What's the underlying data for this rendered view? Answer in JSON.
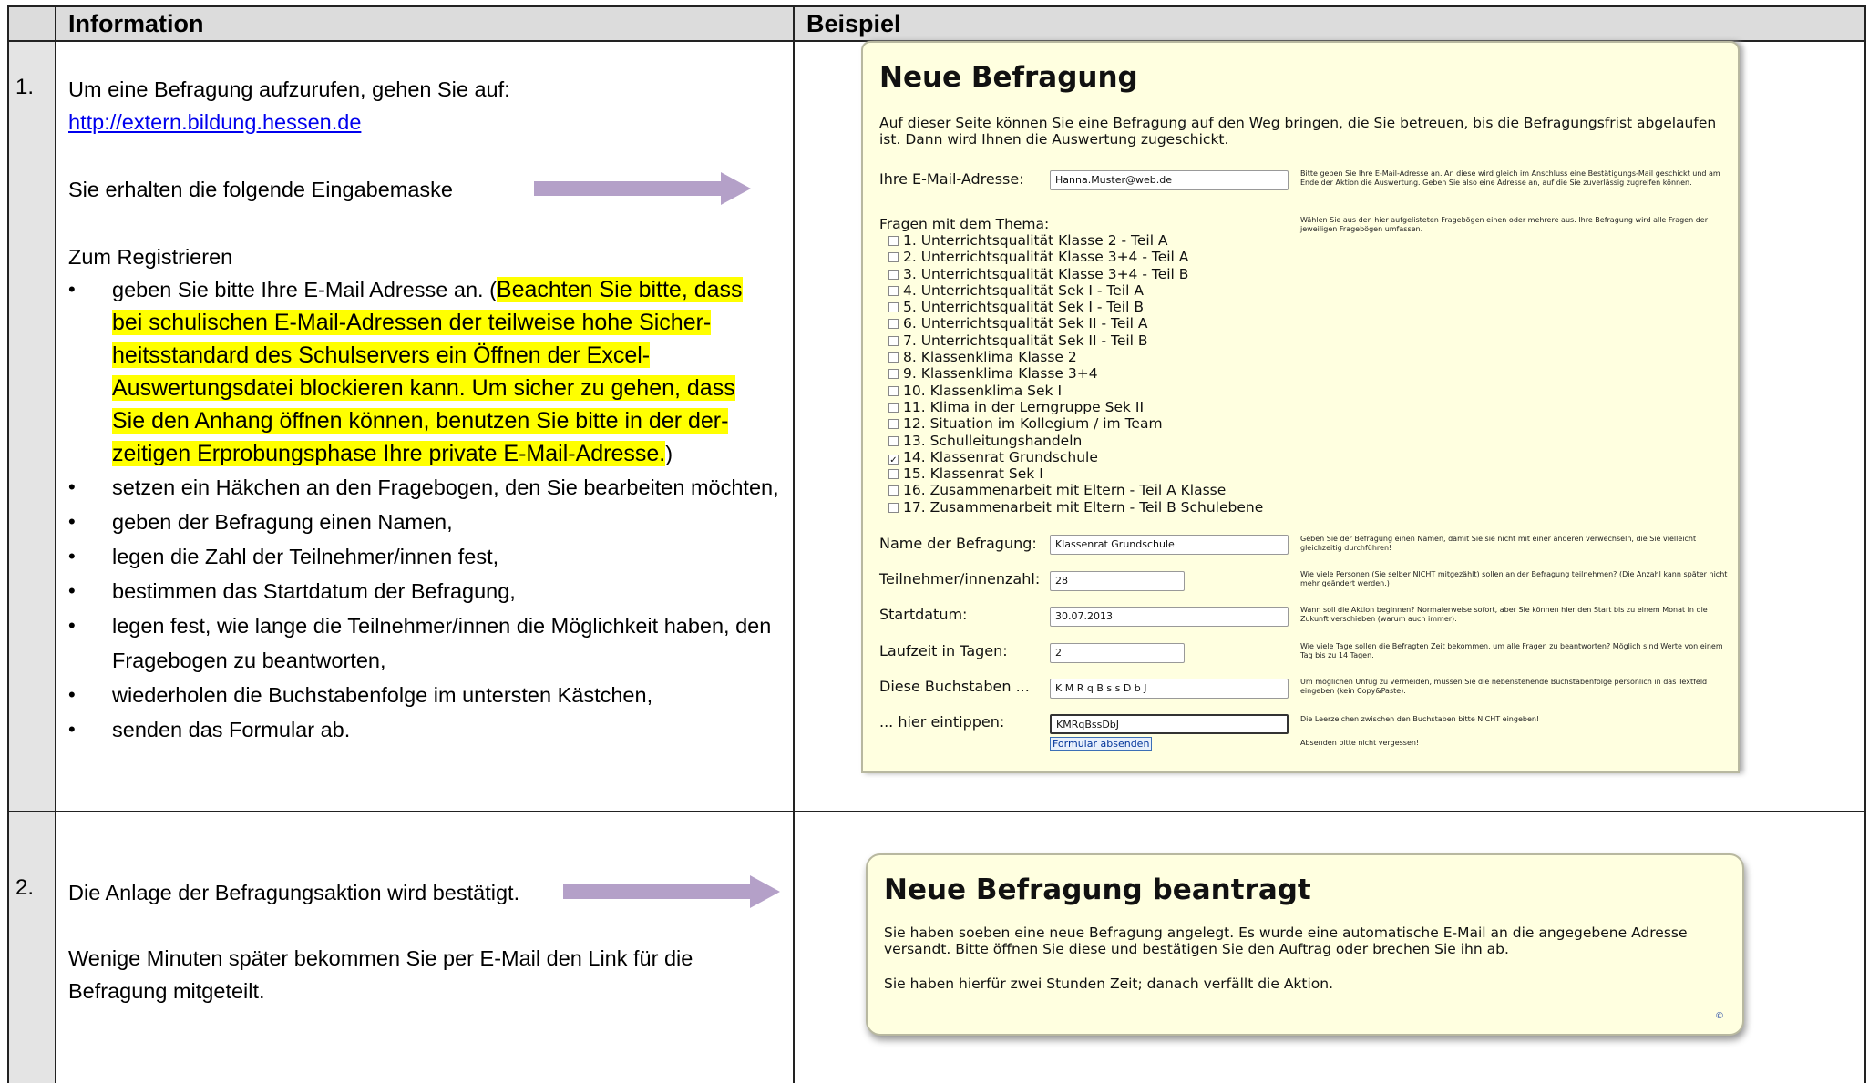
{
  "header": {
    "col_info": "Information",
    "col_example": "Beispiel"
  },
  "row1": {
    "num": "1.",
    "intro": "Um eine Befragung aufzurufen, gehen Sie auf:",
    "link": "http://extern.bildung.hessen.de",
    "mask": "Sie erhalten die folgende Eingabemaske",
    "register": "Zum Registrieren",
    "bullet1_pre": "geben Sie bitte Ihre E-Mail Adresse an. (",
    "bullet1_hl1": "Beachten Sie bitte, dass",
    "bullet1_hl2": "bei schulischen E-Mail-Adressen der teilweise hohe Sicher-",
    "bullet1_hl3": "heitsstandard des Schulservers ein Öffnen der Excel-",
    "bullet1_hl4": "Auswertungsdatei blockieren kann. Um sicher zu gehen, dass",
    "bullet1_hl5": "Sie den Anhang öffnen können, benutzen Sie bitte in der der-",
    "bullet1_hl6": "zeitigen Erprobungsphase Ihre private E-Mail-Adresse.",
    "bullet1_post": ")",
    "bullets": [
      "setzen ein Häkchen an den Fragebogen, den Sie bearbeiten möchten,",
      "geben der Befragung einen Namen,",
      "legen die Zahl der Teilnehmer/innen fest,",
      "bestimmen das Startdatum der Befragung,",
      "legen fest, wie lange die Teilnehmer/innen die Möglichkeit haben, den Fragebogen zu beantworten,",
      "wiederholen die Buchstabenfolge im untersten Kästchen,",
      "senden das Formular ab."
    ]
  },
  "form": {
    "title": "Neue Befragung",
    "intro_l1": "Auf dieser Seite können Sie eine Befragung auf den Weg bringen, die Sie betreuen, bis die Befragungsfrist abgelaufen",
    "intro_l2": "ist. Dann wird Ihnen die Auswertung zugeschickt.",
    "email_label": "Ihre E-Mail-Adresse:",
    "email_value": "Hanna.Muster@web.de",
    "email_help": "Bitte geben Sie Ihre E-Mail-Adresse an. An diese wird gleich im Anschluss eine Bestätigungs-Mail geschickt und am Ende der Aktion die Auswertung. Geben Sie also eine Adresse an, auf die Sie zuverlässig zugreifen können.",
    "topics_label": "Fragen mit dem Thema:",
    "topics_help": "Wählen Sie aus den hier aufgelisteten Fragebögen einen oder mehrere aus. Ihre Befragung wird alle Fragen der jeweiligen Fragebögen umfassen.",
    "topics": [
      {
        "label": "1. Unterrichtsqualität Klasse 2 - Teil A",
        "checked": false
      },
      {
        "label": "2. Unterrichtsqualität Klasse 3+4 - Teil A",
        "checked": false
      },
      {
        "label": "3. Unterrichtsqualität Klasse 3+4 - Teil B",
        "checked": false
      },
      {
        "label": "4. Unterrichtsqualität Sek I - Teil A",
        "checked": false
      },
      {
        "label": "5. Unterrichtsqualität Sek I - Teil B",
        "checked": false
      },
      {
        "label": "6. Unterrichtsqualität Sek II - Teil A",
        "checked": false
      },
      {
        "label": "7. Unterrichtsqualität Sek II - Teil B",
        "checked": false
      },
      {
        "label": "8. Klassenklima Klasse 2",
        "checked": false
      },
      {
        "label": "9. Klassenklima Klasse 3+4",
        "checked": false
      },
      {
        "label": "10. Klassenklima Sek I",
        "checked": false
      },
      {
        "label": "11. Klima in der Lerngruppe Sek II",
        "checked": false
      },
      {
        "label": "12. Situation im Kollegium / im Team",
        "checked": false
      },
      {
        "label": "13. Schulleitungshandeln",
        "checked": false
      },
      {
        "label": "14. Klassenrat Grundschule",
        "checked": true
      },
      {
        "label": "15. Klassenrat Sek I",
        "checked": false
      },
      {
        "label": "16. Zusammenarbeit mit Eltern - Teil A Klasse",
        "checked": false
      },
      {
        "label": "17. Zusammenarbeit mit Eltern - Teil B Schulebene",
        "checked": false
      }
    ],
    "name_label": "Name der Befragung:",
    "name_value": "Klassenrat Grundschule",
    "name_help": "Geben Sie der Befragung einen Namen, damit Sie sie nicht mit einer anderen verwechseln, die Sie vielleicht gleichzeitig durchführen!",
    "count_label": "Teilnehmer/innenzahl:",
    "count_value": "28",
    "count_help": "Wie viele Personen (Sie selber NICHT mitgezählt) sollen an der Befragung teilnehmen? (Die Anzahl kann später nicht mehr geändert werden.)",
    "start_label": "Startdatum:",
    "start_value": "30.07.2013",
    "start_help": "Wann soll die Aktion beginnen? Normalerweise sofort, aber Sie können hier den Start bis zu einem Monat in die Zukunft verschieben (warum auch immer).",
    "days_label": "Laufzeit in Tagen:",
    "days_value": "2",
    "days_help": "Wie viele Tage sollen die Befragten Zeit bekommen, um alle Fragen zu beantworten? Möglich sind Werte von einem Tag bis zu 14 Tagen.",
    "captcha_label": "Diese Buchstaben ...",
    "captcha_value": "K M R q B s s D b J",
    "captcha_help": "Um möglichen Unfug zu vermeiden, müssen Sie die nebenstehende Buchstabenfolge persönlich in das Textfeld eingeben (kein Copy&Paste).",
    "enter_label": "... hier eintippen:",
    "enter_value": "KMRqBssDbJ",
    "enter_help": "Die Leerzeichen zwischen den Buchstaben bitte NICHT eingeben!",
    "submit_label": "Formular absenden",
    "submit_help": "Absenden bitte nicht vergessen!"
  },
  "row2": {
    "num": "2.",
    "confirm": "Die Anlage der Befragungsaktion wird bestätigt.",
    "later_l1": "Wenige Minuten später bekommen Sie per E-Mail den Link für die",
    "later_l2": "Befragung mitgeteilt."
  },
  "confirm_panel": {
    "title": "Neue Befragung beantragt",
    "text_l1": "Sie haben soeben eine neue Befragung angelegt. Es wurde eine automatische E-Mail an die angegebene Adresse",
    "text_l2": "versandt. Bitte öffnen Sie diese und bestätigen Sie den Auftrag oder brechen Sie ihn ab.",
    "text_l3": "Sie haben hierfür zwei Stunden Zeit; danach verfällt die Aktion.",
    "copyright": "©"
  },
  "colors": {
    "highlight": "#ffff00",
    "arrow": "#b4a0c8",
    "panel_bg": "#ffffe0"
  }
}
